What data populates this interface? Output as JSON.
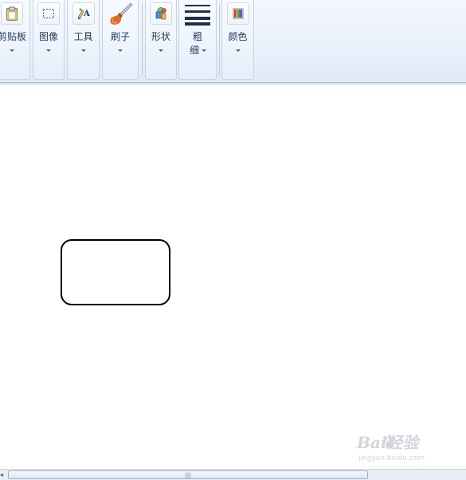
{
  "ribbon": {
    "groups": [
      {
        "id": "clipboard",
        "label": "剪贴板",
        "icon": "clipboard-icon"
      },
      {
        "id": "image",
        "label": "图像",
        "icon": "select-rectangle-icon"
      },
      {
        "id": "tools",
        "label": "工具",
        "icon": "tools-icon"
      },
      {
        "id": "brushes",
        "label": "刷子",
        "icon": "brush-icon"
      },
      {
        "id": "shapes",
        "label": "形状",
        "icon": "shapes-icon"
      },
      {
        "id": "size",
        "label_line1": "粗",
        "label_line2": "细",
        "icon": "line-size-icon"
      },
      {
        "id": "colors",
        "label": "颜色",
        "icon": "color-palette-icon"
      }
    ]
  },
  "canvas": {
    "shape": "rounded-rectangle",
    "stroke_color": "#000000",
    "background": "#ffffff"
  },
  "scrollbar": {
    "grip": "|||"
  },
  "watermark": {
    "main": "Bai经验",
    "sub": "jingyan.baidu.com"
  },
  "colors": {
    "ribbon_bg": "#eaf1fb",
    "label_text": "#1e395b",
    "accent_brush": "#e36a2a"
  }
}
